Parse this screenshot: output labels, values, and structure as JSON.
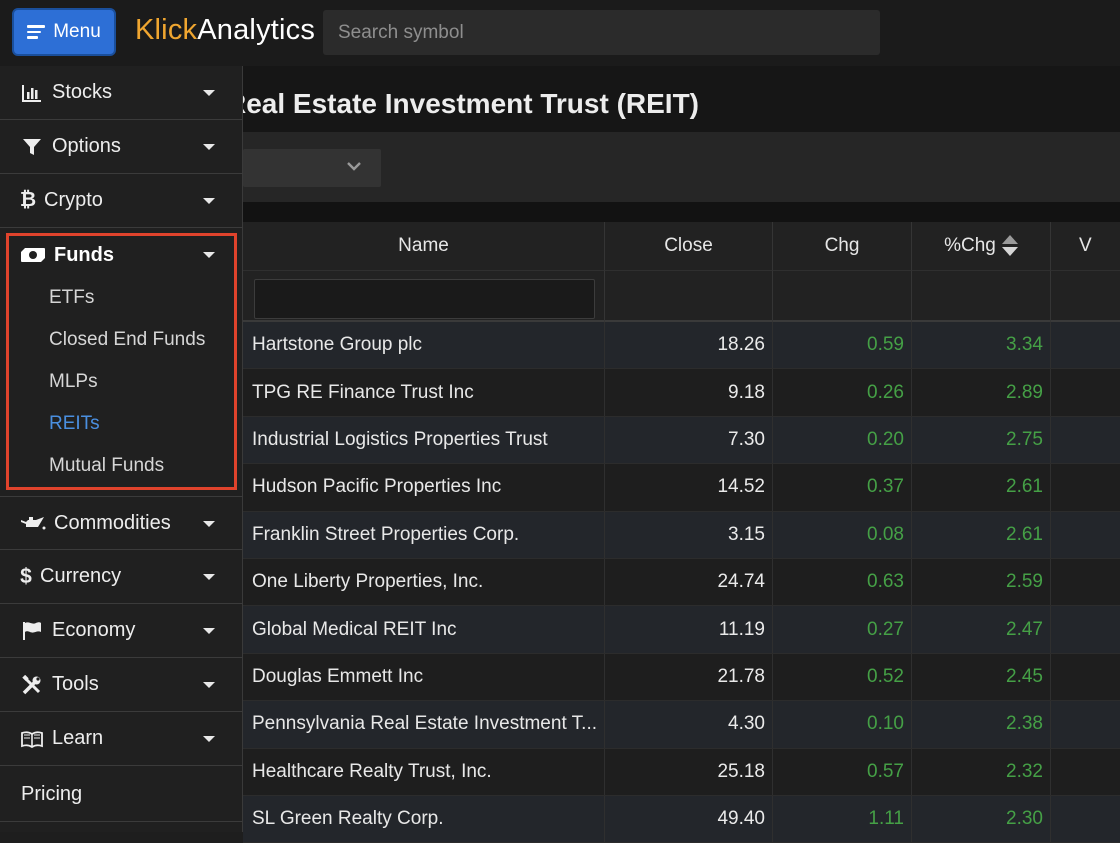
{
  "header": {
    "menu_label": "Menu",
    "logo_part1": "Klick",
    "logo_part2": "Analytics",
    "search_placeholder": "Search symbol"
  },
  "page": {
    "title": "Real Estate Investment Trust (REIT)"
  },
  "sidebar": {
    "items": [
      {
        "label": "Stocks",
        "icon": "bar-chart-icon"
      },
      {
        "label": "Options",
        "icon": "filter-icon"
      },
      {
        "label": "Crypto",
        "icon": "bitcoin-icon"
      },
      {
        "label": "Funds",
        "icon": "money-bill-icon"
      },
      {
        "label": "Commodities",
        "icon": "oil-can-icon"
      },
      {
        "label": "Currency",
        "icon": "dollar-icon"
      },
      {
        "label": "Economy",
        "icon": "flag-icon"
      },
      {
        "label": "Tools",
        "icon": "tools-icon"
      },
      {
        "label": "Learn",
        "icon": "book-icon"
      }
    ],
    "funds_sub": [
      "ETFs",
      "Closed End Funds",
      "MLPs",
      "REITs",
      "Mutual Funds"
    ],
    "active_sub": "REITs",
    "pricing": "Pricing"
  },
  "table": {
    "headers": {
      "name": "Name",
      "close": "Close",
      "chg": "Chg",
      "pchg": "%Chg",
      "vol": "V"
    },
    "rows": [
      {
        "name": "Hartstone Group plc",
        "close": "18.26",
        "chg": "0.59",
        "pchg": "3.34"
      },
      {
        "name": "TPG RE Finance Trust Inc",
        "close": "9.18",
        "chg": "0.26",
        "pchg": "2.89"
      },
      {
        "name": "Industrial Logistics Properties Trust",
        "close": "7.30",
        "chg": "0.20",
        "pchg": "2.75"
      },
      {
        "name": "Hudson Pacific Properties Inc",
        "close": "14.52",
        "chg": "0.37",
        "pchg": "2.61"
      },
      {
        "name": "Franklin Street Properties Corp.",
        "close": "3.15",
        "chg": "0.08",
        "pchg": "2.61"
      },
      {
        "name": "One Liberty Properties, Inc.",
        "close": "24.74",
        "chg": "0.63",
        "pchg": "2.59"
      },
      {
        "name": "Global Medical REIT Inc",
        "close": "11.19",
        "chg": "0.27",
        "pchg": "2.47"
      },
      {
        "name": "Douglas Emmett Inc",
        "close": "21.78",
        "chg": "0.52",
        "pchg": "2.45"
      },
      {
        "name": "Pennsylvania Real Estate Investment T...",
        "close": "4.30",
        "chg": "0.10",
        "pchg": "2.38"
      },
      {
        "name": "Healthcare Realty Trust, Inc.",
        "close": "25.18",
        "chg": "0.57",
        "pchg": "2.32"
      },
      {
        "name": "SL Green Realty Corp.",
        "close": "49.40",
        "chg": "1.11",
        "pchg": "2.30"
      }
    ]
  },
  "colors": {
    "accent": "#2d6fd6",
    "positive": "#45a046",
    "logo": "#f0a630",
    "highlight": "#e0432c",
    "active_link": "#4a8fe0"
  }
}
